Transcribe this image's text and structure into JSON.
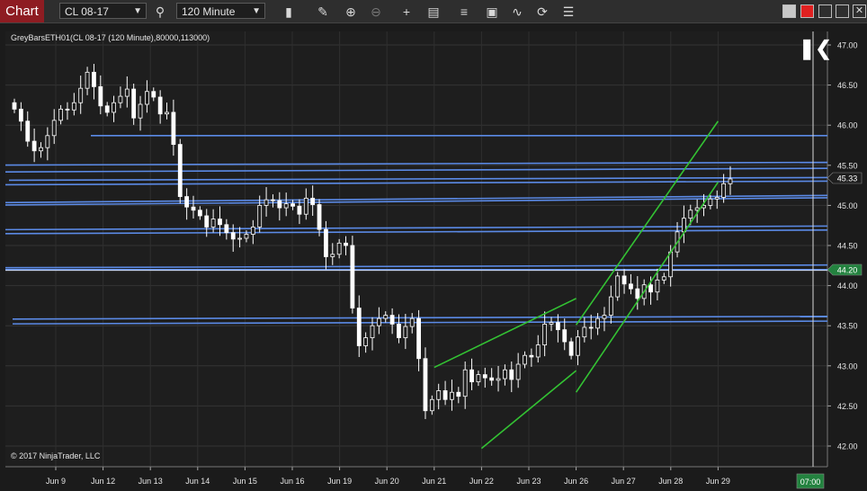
{
  "toolbar": {
    "chart_tab": "Chart",
    "instrument": "CL 08-17",
    "interval": "120 Minute",
    "icons": [
      "search-icon",
      "bars-icon",
      "pencil-icon",
      "zoom-in-icon",
      "zoom-out-icon",
      "crosshair-icon",
      "data-box-icon",
      "bar-type-icon",
      "indicators-icon",
      "strategies-icon",
      "refresh-icon",
      "properties-icon"
    ]
  },
  "window_buttons": [
    "minimize",
    "link-red",
    "restore",
    "close"
  ],
  "chart": {
    "indicator_label": "GreyBarsETH01(CL 08-17 (120 Minute),80000,113000)",
    "copyright": "© 2017 NinjaTrader, LLC",
    "last_price_label": "45.33",
    "line_price_label": "44.20",
    "time_label": "07:00",
    "colors": {
      "horizontal_lines": "#5b8ae6",
      "channel_lines": "#33c233",
      "candle": "#ffffff",
      "last_price": "#1e1e1e",
      "line_price": "#23823f",
      "time": "#23823f"
    }
  },
  "chart_data": {
    "type": "candlestick",
    "x_tick_labels": [
      "Jun 9",
      "Jun 12",
      "Jun 13",
      "Jun 14",
      "Jun 15",
      "Jun 16",
      "Jun 19",
      "Jun 20",
      "Jun 21",
      "Jun 22",
      "Jun 23",
      "Jun 26",
      "Jun 27",
      "Jun 28",
      "Jun 29"
    ],
    "y_tick_labels": [
      "47.00",
      "46.50",
      "46.00",
      "45.50",
      "45.00",
      "44.50",
      "44.00",
      "43.50",
      "43.00",
      "42.50",
      "42.00"
    ],
    "ylim": [
      41.8,
      47.1
    ],
    "closes": [
      46.2,
      46.05,
      45.8,
      45.68,
      45.72,
      45.87,
      46.06,
      46.2,
      46.19,
      46.28,
      46.46,
      46.66,
      46.48,
      46.24,
      46.16,
      46.28,
      46.36,
      46.45,
      46.09,
      46.26,
      46.42,
      46.35,
      46.14,
      46.16,
      45.76,
      45.11,
      44.98,
      44.94,
      44.87,
      44.73,
      44.83,
      44.76,
      44.66,
      44.58,
      44.59,
      44.64,
      44.73,
      45.0,
      45.07,
      45.06,
      44.97,
      45.02,
      44.99,
      44.89,
      45.09,
      45.01,
      44.7,
      44.36,
      44.39,
      44.53,
      44.5,
      43.72,
      43.25,
      43.35,
      43.5,
      43.59,
      43.63,
      43.52,
      43.35,
      43.49,
      43.59,
      43.09,
      42.44,
      42.58,
      42.69,
      42.58,
      42.67,
      42.62,
      42.95,
      42.8,
      42.89,
      42.85,
      42.82,
      42.84,
      42.95,
      42.83,
      43.02,
      43.13,
      43.11,
      43.26,
      43.52,
      43.54,
      43.45,
      43.3,
      43.13,
      43.36,
      43.48,
      43.47,
      43.59,
      43.63,
      43.86,
      44.12,
      44.02,
      43.96,
      43.84,
      44.01,
      43.92,
      44.07,
      44.11,
      44.42,
      44.67,
      44.84,
      44.94,
      44.97,
      45.0,
      45.08,
      45.1,
      45.27,
      45.33
    ],
    "horizontal_lines": [
      45.87,
      45.52,
      45.44,
      45.33,
      45.28,
      45.08,
      45.05,
      44.72,
      44.67,
      44.24,
      44.2,
      43.6,
      43.54
    ],
    "channels": [
      {
        "from": [
          "Jun 21",
          42.98
        ],
        "to": [
          "Jun 26",
          43.84
        ]
      },
      {
        "from": [
          "Jun 22",
          41.97
        ],
        "to": [
          "Jun 26",
          42.94
        ]
      },
      {
        "from": [
          "Jun 26",
          43.51
        ],
        "to": [
          "Jun 29",
          46.05
        ]
      },
      {
        "from": [
          "Jun 26",
          42.67
        ],
        "to": [
          "Jun 29",
          45.29
        ]
      }
    ]
  }
}
